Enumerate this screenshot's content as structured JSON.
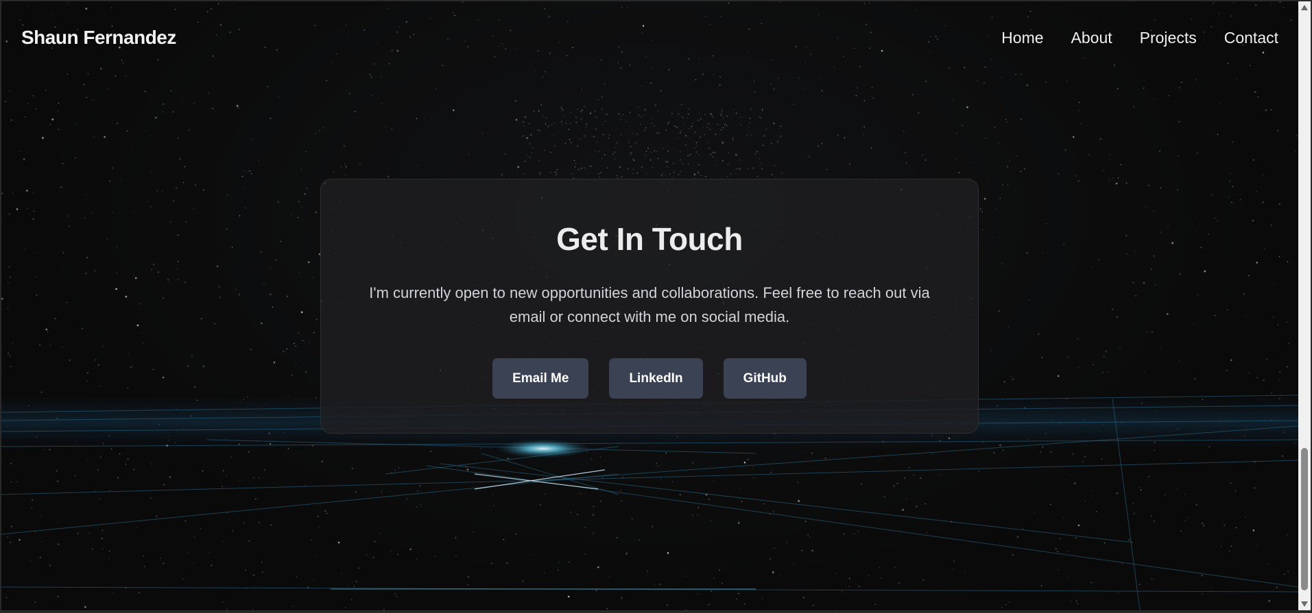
{
  "site": {
    "brand": "Shaun Fernandez"
  },
  "nav": {
    "items": [
      {
        "label": "Home"
      },
      {
        "label": "About"
      },
      {
        "label": "Projects"
      },
      {
        "label": "Contact"
      }
    ]
  },
  "contact": {
    "title": "Get In Touch",
    "text": "I'm currently open to new opportunities and collaborations. Feel free to reach out via email or connect with me on social media.",
    "buttons": [
      {
        "label": "Email Me"
      },
      {
        "label": "LinkedIn"
      },
      {
        "label": "GitHub"
      }
    ]
  },
  "theme": {
    "background": "#0b0b0b",
    "card": "#1e1f21",
    "button": "#3a4253",
    "grid_accent": "#3aa7c9"
  }
}
